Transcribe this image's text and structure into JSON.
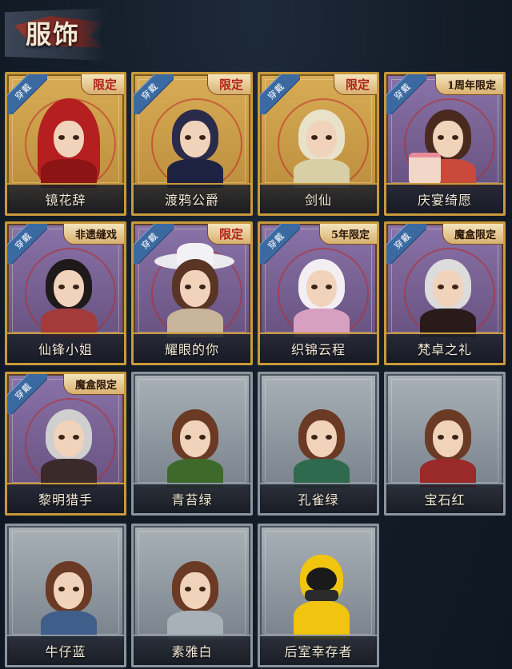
{
  "header": {
    "title": "服饰"
  },
  "badge_label": "穿戴",
  "cards": [
    {
      "name": "镜花辞",
      "tag": "限定",
      "style": "gold",
      "equipped": true,
      "icon": "portrait-red-hood"
    },
    {
      "name": "渡鸦公爵",
      "tag": "限定",
      "style": "gold",
      "equipped": true,
      "icon": "portrait-raven-duke"
    },
    {
      "name": "剑仙",
      "tag": "限定",
      "style": "gold",
      "equipped": true,
      "icon": "portrait-sword-immortal"
    },
    {
      "name": "庆宴绮愿",
      "tag": "1周年限定",
      "style": "purple",
      "equipped": true,
      "icon": "portrait-birthday-cake"
    },
    {
      "name": "仙锋小姐",
      "tag": "非遗缝戏",
      "style": "purple",
      "equipped": true,
      "icon": "portrait-opera-lady"
    },
    {
      "name": "耀眼的你",
      "tag": "限定",
      "style": "purple",
      "equipped": true,
      "icon": "portrait-cowgirl"
    },
    {
      "name": "织锦云程",
      "tag": "5年限定",
      "style": "purple",
      "equipped": true,
      "icon": "portrait-silver-hair"
    },
    {
      "name": "梵卓之礼",
      "tag": "魔盒限定",
      "style": "purple",
      "equipped": true,
      "icon": "portrait-vampire"
    },
    {
      "name": "黎明猎手",
      "tag": "魔盒限定",
      "style": "purple",
      "equipped": true,
      "icon": "portrait-dawn-hunter"
    },
    {
      "name": "青苔绿",
      "tag": "",
      "style": "grey",
      "equipped": false,
      "icon": "portrait-girl-green"
    },
    {
      "name": "孔雀绿",
      "tag": "",
      "style": "grey",
      "equipped": false,
      "icon": "portrait-girl-teal"
    },
    {
      "name": "宝石红",
      "tag": "",
      "style": "grey",
      "equipped": false,
      "icon": "portrait-girl-red"
    },
    {
      "name": "牛仔蓝",
      "tag": "",
      "style": "grey",
      "equipped": false,
      "icon": "portrait-girl-blue"
    },
    {
      "name": "素雅白",
      "tag": "",
      "style": "grey",
      "equipped": false,
      "icon": "portrait-girl-white"
    },
    {
      "name": "后室幸存者",
      "tag": "",
      "style": "grey",
      "equipped": false,
      "icon": "portrait-hazmat-survivor"
    }
  ]
}
